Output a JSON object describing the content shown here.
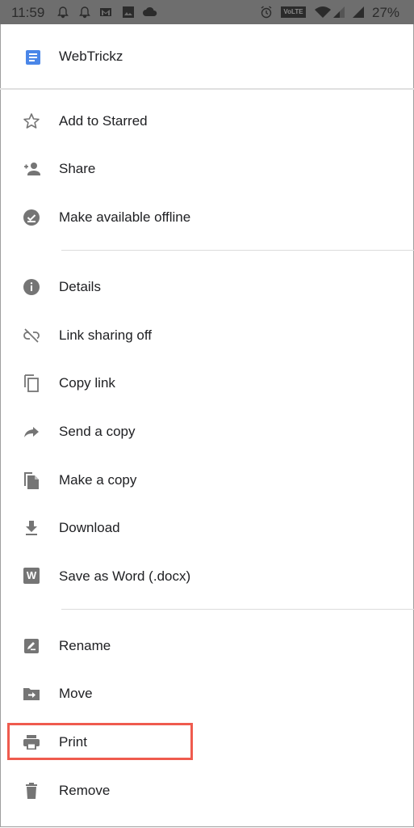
{
  "status_bar": {
    "time": "11:59",
    "notification_icons": [
      "bell-icon",
      "bell-icon",
      "gmail-icon",
      "image-icon",
      "cloud-icon"
    ],
    "system_icons": [
      "alarm-icon",
      "volte-badge",
      "wifi-icon",
      "signal-icon",
      "signal-icon"
    ],
    "volte_label": "VoLTE",
    "battery": "27%"
  },
  "header": {
    "icon": "google-docs-icon",
    "title": "WebTrickz",
    "accent_color": "#4a86e8"
  },
  "menu": {
    "groups": [
      {
        "items": [
          {
            "label": "Add to Starred",
            "icon": "star-outline-icon"
          },
          {
            "label": "Share",
            "icon": "person-add-icon"
          },
          {
            "label": "Make available offline",
            "icon": "offline-check-icon"
          }
        ]
      },
      {
        "items": [
          {
            "label": "Details",
            "icon": "info-icon"
          },
          {
            "label": "Link sharing off",
            "icon": "link-off-icon"
          },
          {
            "label": "Copy link",
            "icon": "copy-icon"
          },
          {
            "label": "Send a copy",
            "icon": "forward-arrow-icon"
          },
          {
            "label": "Make a copy",
            "icon": "file-copy-icon"
          },
          {
            "label": "Download",
            "icon": "download-icon"
          },
          {
            "label": "Save as Word (.docx)",
            "icon": "word-icon"
          }
        ]
      },
      {
        "items": [
          {
            "label": "Rename",
            "icon": "rename-icon"
          },
          {
            "label": "Move",
            "icon": "move-folder-icon"
          },
          {
            "label": "Print",
            "icon": "printer-icon",
            "highlighted": true
          },
          {
            "label": "Remove",
            "icon": "trash-icon"
          }
        ]
      }
    ]
  },
  "word_icon_letter": "W",
  "highlight_color": "#ef5b4e",
  "icon_color": "#757575"
}
